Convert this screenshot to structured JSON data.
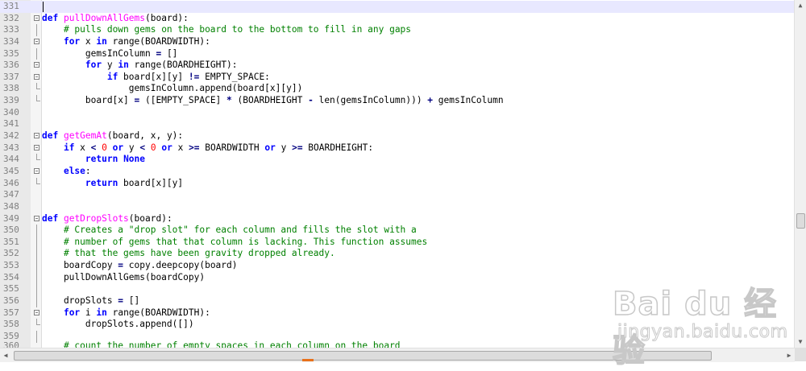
{
  "editor": {
    "current_line": 331,
    "lines": [
      {
        "n": "331",
        "fold": "none",
        "tokens": []
      },
      {
        "n": "332",
        "fold": "box",
        "tokens": [
          [
            "def",
            "def"
          ],
          [
            "t",
            " "
          ],
          [
            "fn",
            "pullDownAllGems"
          ],
          [
            "t",
            "(board):"
          ]
        ]
      },
      {
        "n": "333",
        "fold": "vline",
        "tokens": [
          [
            "t",
            "    "
          ],
          [
            "com",
            "# pulls down gems on the board to the bottom to fill in any gaps"
          ]
        ]
      },
      {
        "n": "334",
        "fold": "box",
        "tokens": [
          [
            "t",
            "    "
          ],
          [
            "kw",
            "for"
          ],
          [
            "t",
            " x "
          ],
          [
            "kw",
            "in"
          ],
          [
            "t",
            " range(BOARDWIDTH):"
          ]
        ]
      },
      {
        "n": "335",
        "fold": "vline",
        "tokens": [
          [
            "t",
            "        gemsInColumn "
          ],
          [
            "op",
            "="
          ],
          [
            "t",
            " []"
          ]
        ]
      },
      {
        "n": "336",
        "fold": "box",
        "tokens": [
          [
            "t",
            "        "
          ],
          [
            "kw",
            "for"
          ],
          [
            "t",
            " y "
          ],
          [
            "kw",
            "in"
          ],
          [
            "t",
            " range(BOARDHEIGHT):"
          ]
        ]
      },
      {
        "n": "337",
        "fold": "box",
        "tokens": [
          [
            "t",
            "            "
          ],
          [
            "kw",
            "if"
          ],
          [
            "t",
            " board[x][y] "
          ],
          [
            "op",
            "!="
          ],
          [
            "t",
            " EMPTY_SPACE:"
          ]
        ]
      },
      {
        "n": "338",
        "fold": "end",
        "tokens": [
          [
            "t",
            "                gemsInColumn.append(board[x][y])"
          ]
        ]
      },
      {
        "n": "339",
        "fold": "end",
        "tokens": [
          [
            "t",
            "        board[x] "
          ],
          [
            "op",
            "="
          ],
          [
            "t",
            " ([EMPTY_SPACE] "
          ],
          [
            "op",
            "*"
          ],
          [
            "t",
            " (BOARDHEIGHT "
          ],
          [
            "op",
            "-"
          ],
          [
            "t",
            " len(gemsInColumn))) "
          ],
          [
            "op",
            "+"
          ],
          [
            "t",
            " gemsInColumn"
          ]
        ]
      },
      {
        "n": "340",
        "fold": "none",
        "tokens": []
      },
      {
        "n": "341",
        "fold": "none",
        "tokens": []
      },
      {
        "n": "342",
        "fold": "box",
        "tokens": [
          [
            "def",
            "def"
          ],
          [
            "t",
            " "
          ],
          [
            "fn",
            "getGemAt"
          ],
          [
            "t",
            "(board, x, y):"
          ]
        ]
      },
      {
        "n": "343",
        "fold": "box",
        "tokens": [
          [
            "t",
            "    "
          ],
          [
            "kw",
            "if"
          ],
          [
            "t",
            " x "
          ],
          [
            "op",
            "<"
          ],
          [
            "t",
            " "
          ],
          [
            "num",
            "0"
          ],
          [
            "t",
            " "
          ],
          [
            "kw",
            "or"
          ],
          [
            "t",
            " y "
          ],
          [
            "op",
            "<"
          ],
          [
            "t",
            " "
          ],
          [
            "num",
            "0"
          ],
          [
            "t",
            " "
          ],
          [
            "kw",
            "or"
          ],
          [
            "t",
            " x "
          ],
          [
            "op",
            ">="
          ],
          [
            "t",
            " BOARDWIDTH "
          ],
          [
            "kw",
            "or"
          ],
          [
            "t",
            " y "
          ],
          [
            "op",
            ">="
          ],
          [
            "t",
            " BOARDHEIGHT:"
          ]
        ]
      },
      {
        "n": "344",
        "fold": "end",
        "tokens": [
          [
            "t",
            "        "
          ],
          [
            "kw",
            "return"
          ],
          [
            "t",
            " "
          ],
          [
            "kw",
            "None"
          ]
        ]
      },
      {
        "n": "345",
        "fold": "box",
        "tokens": [
          [
            "t",
            "    "
          ],
          [
            "kw",
            "else"
          ],
          [
            "t",
            ":"
          ]
        ]
      },
      {
        "n": "346",
        "fold": "end",
        "tokens": [
          [
            "t",
            "        "
          ],
          [
            "kw",
            "return"
          ],
          [
            "t",
            " board[x][y]"
          ]
        ]
      },
      {
        "n": "347",
        "fold": "none",
        "tokens": []
      },
      {
        "n": "348",
        "fold": "none",
        "tokens": []
      },
      {
        "n": "349",
        "fold": "box",
        "tokens": [
          [
            "def",
            "def"
          ],
          [
            "t",
            " "
          ],
          [
            "fn",
            "getDropSlots"
          ],
          [
            "t",
            "(board):"
          ]
        ]
      },
      {
        "n": "350",
        "fold": "vline",
        "tokens": [
          [
            "t",
            "    "
          ],
          [
            "com",
            "# Creates a \"drop slot\" for each column and fills the slot with a"
          ]
        ]
      },
      {
        "n": "351",
        "fold": "vline",
        "tokens": [
          [
            "t",
            "    "
          ],
          [
            "com",
            "# number of gems that that column is lacking. This function assumes"
          ]
        ]
      },
      {
        "n": "352",
        "fold": "vline",
        "tokens": [
          [
            "t",
            "    "
          ],
          [
            "com",
            "# that the gems have been gravity dropped already."
          ]
        ]
      },
      {
        "n": "353",
        "fold": "vline",
        "tokens": [
          [
            "t",
            "    boardCopy "
          ],
          [
            "op",
            "="
          ],
          [
            "t",
            " copy.deepcopy(board)"
          ]
        ]
      },
      {
        "n": "354",
        "fold": "vline",
        "tokens": [
          [
            "t",
            "    pullDownAllGems(boardCopy)"
          ]
        ]
      },
      {
        "n": "355",
        "fold": "vline",
        "tokens": []
      },
      {
        "n": "356",
        "fold": "vline",
        "tokens": [
          [
            "t",
            "    dropSlots "
          ],
          [
            "op",
            "="
          ],
          [
            "t",
            " []"
          ]
        ]
      },
      {
        "n": "357",
        "fold": "box",
        "tokens": [
          [
            "t",
            "    "
          ],
          [
            "kw",
            "for"
          ],
          [
            "t",
            " i "
          ],
          [
            "kw",
            "in"
          ],
          [
            "t",
            " range(BOARDWIDTH):"
          ]
        ]
      },
      {
        "n": "358",
        "fold": "end",
        "tokens": [
          [
            "t",
            "        dropSlots.append([])"
          ]
        ]
      },
      {
        "n": "359",
        "fold": "vline",
        "tokens": []
      }
    ],
    "partial_line": {
      "n": "360",
      "text": "    # count the number of empty spaces in each column on the board"
    }
  },
  "watermark": {
    "logo": "Bai du 经验",
    "url": "jingyan.baidu.com"
  },
  "scrollbars": {
    "up_arrow": "▲",
    "down_arrow": "▼",
    "left_arrow": "◀",
    "right_arrow": "▶"
  },
  "colors": {
    "keyword": "#0000ff",
    "function_name": "#ff00ff",
    "comment": "#008000",
    "number": "#ff0000",
    "operator": "#000080",
    "gutter": "#e9e9e9"
  }
}
